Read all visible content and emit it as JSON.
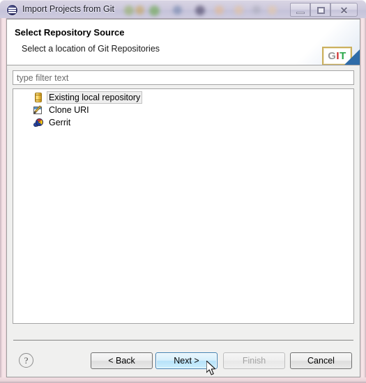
{
  "window": {
    "title": "Import Projects from Git",
    "title_icon": "eclipse-circle-icon",
    "controls": [
      {
        "name": "minimize",
        "label": "–",
        "icon": "minimize-icon"
      },
      {
        "name": "maximize",
        "label": "□",
        "icon": "restore-icon"
      },
      {
        "name": "close",
        "label": "✕",
        "icon": "close-icon"
      }
    ]
  },
  "header": {
    "title": "Select Repository Source",
    "subtitle": "Select a location of Git Repositories",
    "logo": {
      "name": "git-logo",
      "letters": [
        {
          "char": "G",
          "color": "#9a9a9a"
        },
        {
          "char": "I",
          "color": "#cc2a2a"
        },
        {
          "char": "T",
          "color": "#2aa84a"
        }
      ]
    }
  },
  "filter": {
    "placeholder": "type filter text",
    "value": ""
  },
  "tree": {
    "items": [
      {
        "label": "Existing local repository",
        "icon": "repository-cylinder-icon",
        "selected": true
      },
      {
        "label": "Clone URI",
        "icon": "clone-uri-pencil-icon",
        "selected": false
      },
      {
        "label": "Gerrit",
        "icon": "gerrit-icon",
        "selected": false
      }
    ]
  },
  "buttons": {
    "help": "?",
    "back": "< Back",
    "next": "Next >",
    "finish": "Finish",
    "cancel": "Cancel"
  },
  "colors": {
    "accent": "#3c7fb1",
    "next_button_fill": "#b7e2f9",
    "banner_wedge": "#2f6ca8",
    "dialog_background": "#f0f0ef",
    "frame_glass": "#f3dfe3"
  }
}
